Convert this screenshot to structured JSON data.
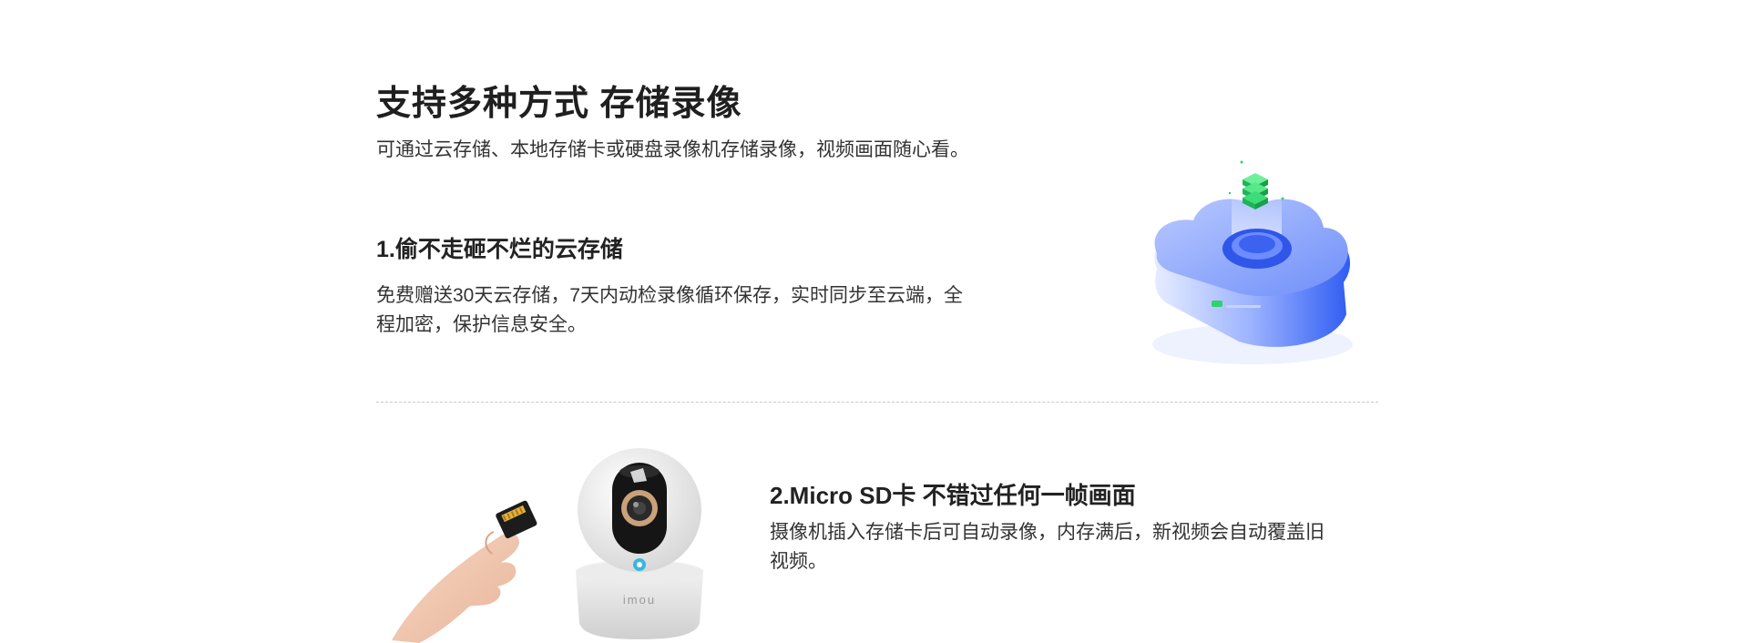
{
  "header": {
    "title": "支持多种方式 存储录像",
    "subtitle": "可通过云存储、本地存储卡或硬盘录像机存储录像，视频画面随心看。"
  },
  "section1": {
    "title": "1.偷不走砸不烂的云存储",
    "description": "免费赠送30天云存储，7天内动检录像循环保存，实时同步至云端，全程加密，保护信息安全。"
  },
  "section2": {
    "title": "2.Micro SD卡 不错过任何一帧画面",
    "description": "摄像机插入存储卡后可自动录像，内存满后，新视频会自动覆盖旧视频。",
    "camera_brand": "imou"
  },
  "colors": {
    "cloud_blue": "#3f6cf6",
    "cloud_light": "#8fa8ff",
    "stack_green": "#2ed36a",
    "camera_white": "#f2f2f2",
    "camera_lens_ring": "#c9a27a",
    "accent_teal": "#38b6e0"
  }
}
